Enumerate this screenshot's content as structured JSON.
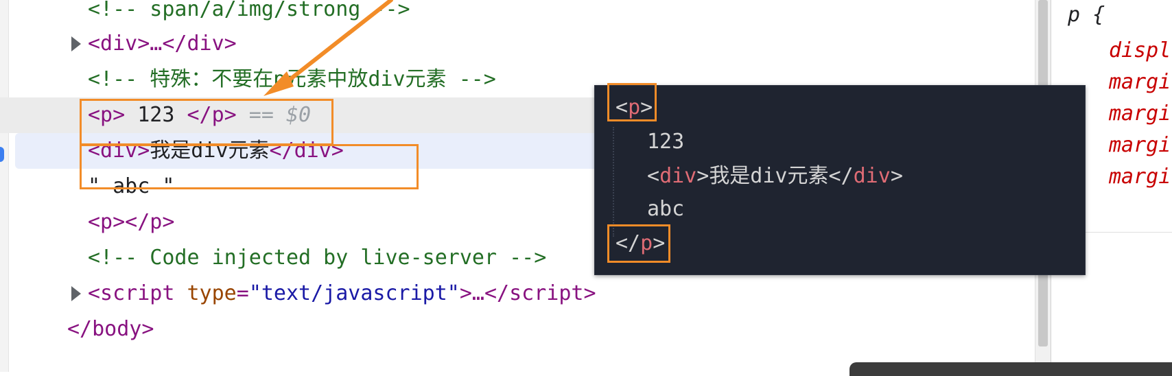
{
  "dom_tree": {
    "comment_inline": "<!-- span/a/img/strong -->",
    "div_collapsed": "<div>…</div>",
    "comment_special": "<!-- 特殊：不要在p元素中放div元素 -->",
    "selected_line": {
      "open": "<p>",
      "text": " 123 ",
      "close": "</p>",
      "eq": " == ",
      "ref": "$0"
    },
    "div_line": {
      "open": "<div>",
      "text": "我是div元素",
      "close": "</div>"
    },
    "text_node": "\" abc \"",
    "empty_p": "<p></p>",
    "comment_live": "<!-- Code injected by live-server -->",
    "script_line": {
      "open": "<script",
      "attr_name": " type",
      "eq": "=",
      "attr_value": "\"text/javascript\"",
      "rest": ">…</",
      "close_name": "script",
      "end": ">"
    },
    "body_close": "</body>",
    "more_button": "···"
  },
  "tooltip": {
    "open_bracket": "<",
    "open_tag": "p",
    "open_end": ">",
    "line1": "123",
    "div_open_bracket": "<",
    "div_tag": "div",
    "div_open_end": ">",
    "div_text": "我是div元素",
    "div_close_bracket": "</",
    "div_close_tag": "div",
    "div_close_end": ">",
    "line3": "abc",
    "close_bracket": "</",
    "close_tag": "p",
    "close_end": ">"
  },
  "styles": {
    "selector": "p {",
    "props": [
      "displ",
      "margi",
      "margi",
      "margi",
      "margi"
    ]
  },
  "colors": {
    "annotation": "#f28c28",
    "tag": "#881280",
    "comment": "#236e25",
    "tooltip_bg": "#1f2430"
  }
}
